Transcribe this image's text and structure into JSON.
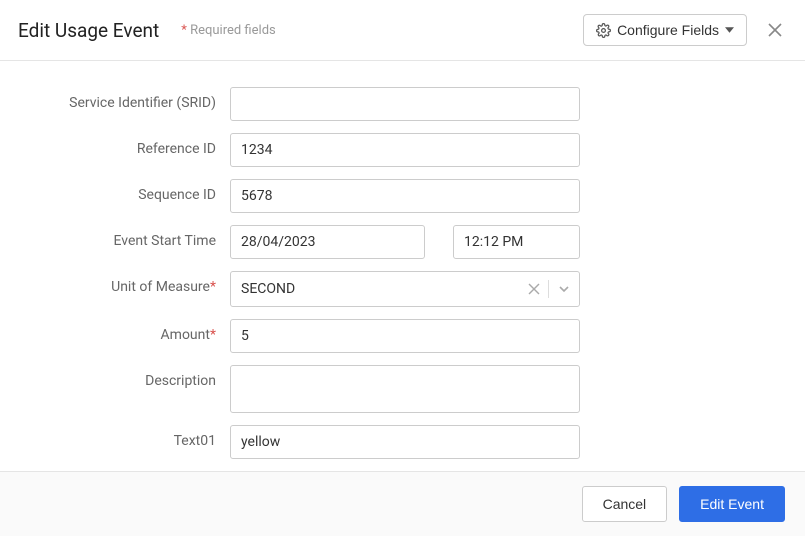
{
  "header": {
    "title": "Edit Usage Event",
    "requiredNote": "Required fields",
    "configureLabel": "Configure Fields"
  },
  "form": {
    "srid": {
      "label": "Service Identifier (SRID)",
      "value": ""
    },
    "referenceId": {
      "label": "Reference ID",
      "value": "1234"
    },
    "sequenceId": {
      "label": "Sequence ID",
      "value": "5678"
    },
    "eventStart": {
      "label": "Event Start Time",
      "date": "28/04/2023",
      "time": "12:12 PM"
    },
    "uom": {
      "label": "Unit of Measure",
      "value": "SECOND"
    },
    "amount": {
      "label": "Amount",
      "value": "5"
    },
    "description": {
      "label": "Description",
      "value": ""
    },
    "text01": {
      "label": "Text01",
      "value": "yellow"
    }
  },
  "footer": {
    "cancel": "Cancel",
    "submit": "Edit Event"
  }
}
